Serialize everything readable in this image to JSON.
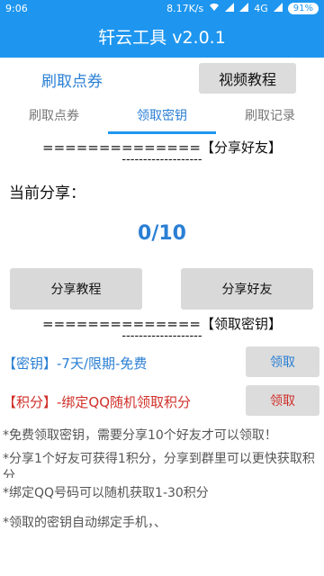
{
  "status_bar": {
    "time": "9:06",
    "speed": "8.17K/s",
    "network": "4G",
    "battery": "91%"
  },
  "app_bar": {
    "title": "轩云工具 v2.0.1"
  },
  "top_row": {
    "title": "刷取点券",
    "video_button": "视频教程"
  },
  "tabs": [
    {
      "label": "刷取点券"
    },
    {
      "label": "领取密钥"
    },
    {
      "label": "刷取记录"
    }
  ],
  "share_section": {
    "header": "==============【分享好友】",
    "underline": "-------------------",
    "label": "当前分享：",
    "count": "0/10",
    "tutorial_button": "分享教程",
    "share_button": "分享好友"
  },
  "key_section": {
    "header": "==============【领取密钥】",
    "underline": "-------------------",
    "rows": [
      {
        "label": "【密钥】-7天/限期-免费",
        "button": "领取"
      },
      {
        "label": "【积分】-绑定QQ随机领取积分",
        "button": "领取"
      }
    ]
  },
  "notes": [
    "*免费领取密钥，需要分享10个好友才可以领取！",
    "*分享1个好友可获得1积分，分享到群里可以更快获取积分",
    "*绑定QQ号码可以随机获取1-30积分",
    "*领取的密钥自动绑定手机，、"
  ],
  "colors": {
    "primary": "#1e96ef",
    "link_blue": "#2a7fd4",
    "red": "#d0302a",
    "button_gray": "#dcdcdc"
  }
}
